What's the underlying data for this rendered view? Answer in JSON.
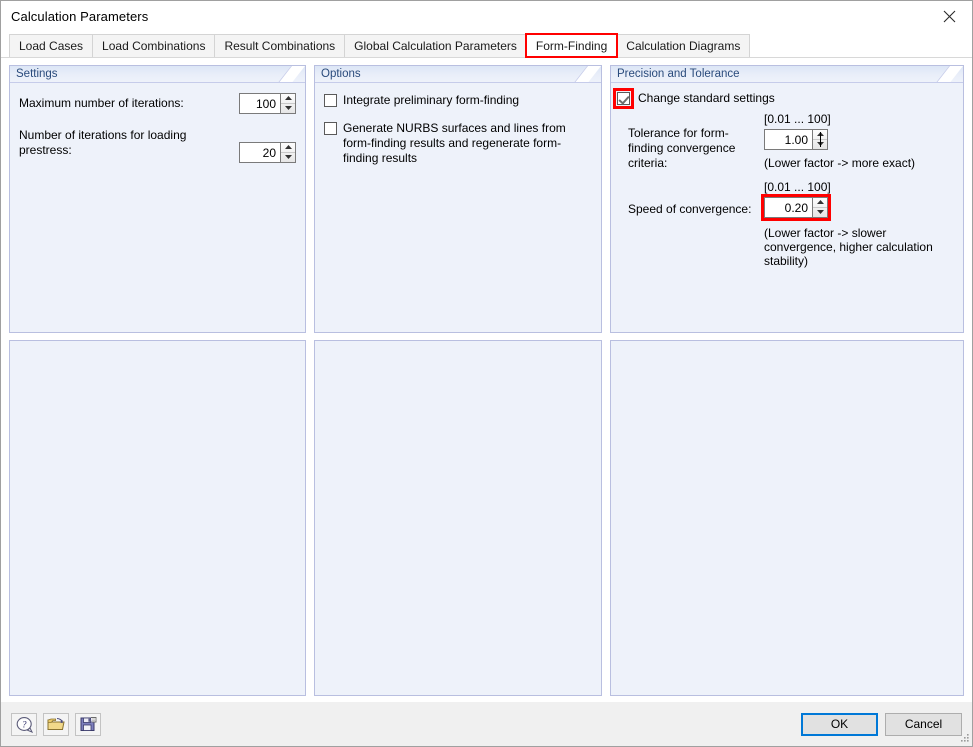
{
  "window": {
    "title": "Calculation Parameters",
    "close_icon": "close-icon"
  },
  "tabs": [
    {
      "label": "Load Cases",
      "state": "inactive"
    },
    {
      "label": "Load Combinations",
      "state": "inactive"
    },
    {
      "label": "Result Combinations",
      "state": "inactive"
    },
    {
      "label": "Global Calculation Parameters",
      "state": "inactive"
    },
    {
      "label": "Form-Finding",
      "state": "active-highlighted"
    },
    {
      "label": "Calculation Diagrams",
      "state": "inactive"
    }
  ],
  "settings_panel": {
    "header": "Settings",
    "max_iterations_label": "Maximum number of iterations:",
    "max_iterations_value": "100",
    "prestress_iterations_label": "Number of iterations for loading prestress:",
    "prestress_iterations_value": "20"
  },
  "options_panel": {
    "header": "Options",
    "checkbox_integrate_label": "Integrate preliminary form-finding",
    "checkbox_integrate_checked": "false",
    "checkbox_nurbs_label": "Generate NURBS surfaces and lines from form-finding results and regenerate form-finding results",
    "checkbox_nurbs_checked": "false"
  },
  "precision_panel": {
    "header": "Precision and Tolerance",
    "change_standard_label": "Change standard settings",
    "change_standard_checked": "true",
    "tolerance_label": "Tolerance for form-finding convergence criteria:",
    "tolerance_range": "[0.01 ... 100]",
    "tolerance_value": "1.00",
    "tolerance_hint": "(Lower factor -> more exact)",
    "speed_label": "Speed of convergence:",
    "speed_range": "[0.01 ... 100]",
    "speed_value": "0.20",
    "speed_hint": "(Lower factor -> slower convergence, higher calculation stability)"
  },
  "footer": {
    "help_icon": "help-icon",
    "open_icon": "open-folder-icon",
    "save_icon": "save-floppy-icon",
    "ok_label": "OK",
    "cancel_label": "Cancel"
  },
  "colors": {
    "highlight": "#ff0000",
    "panel_border": "#b9bfe0",
    "panel_bg": "#eef2fa",
    "header_text": "#2a4b7c",
    "focus_blue": "#0078d7"
  }
}
